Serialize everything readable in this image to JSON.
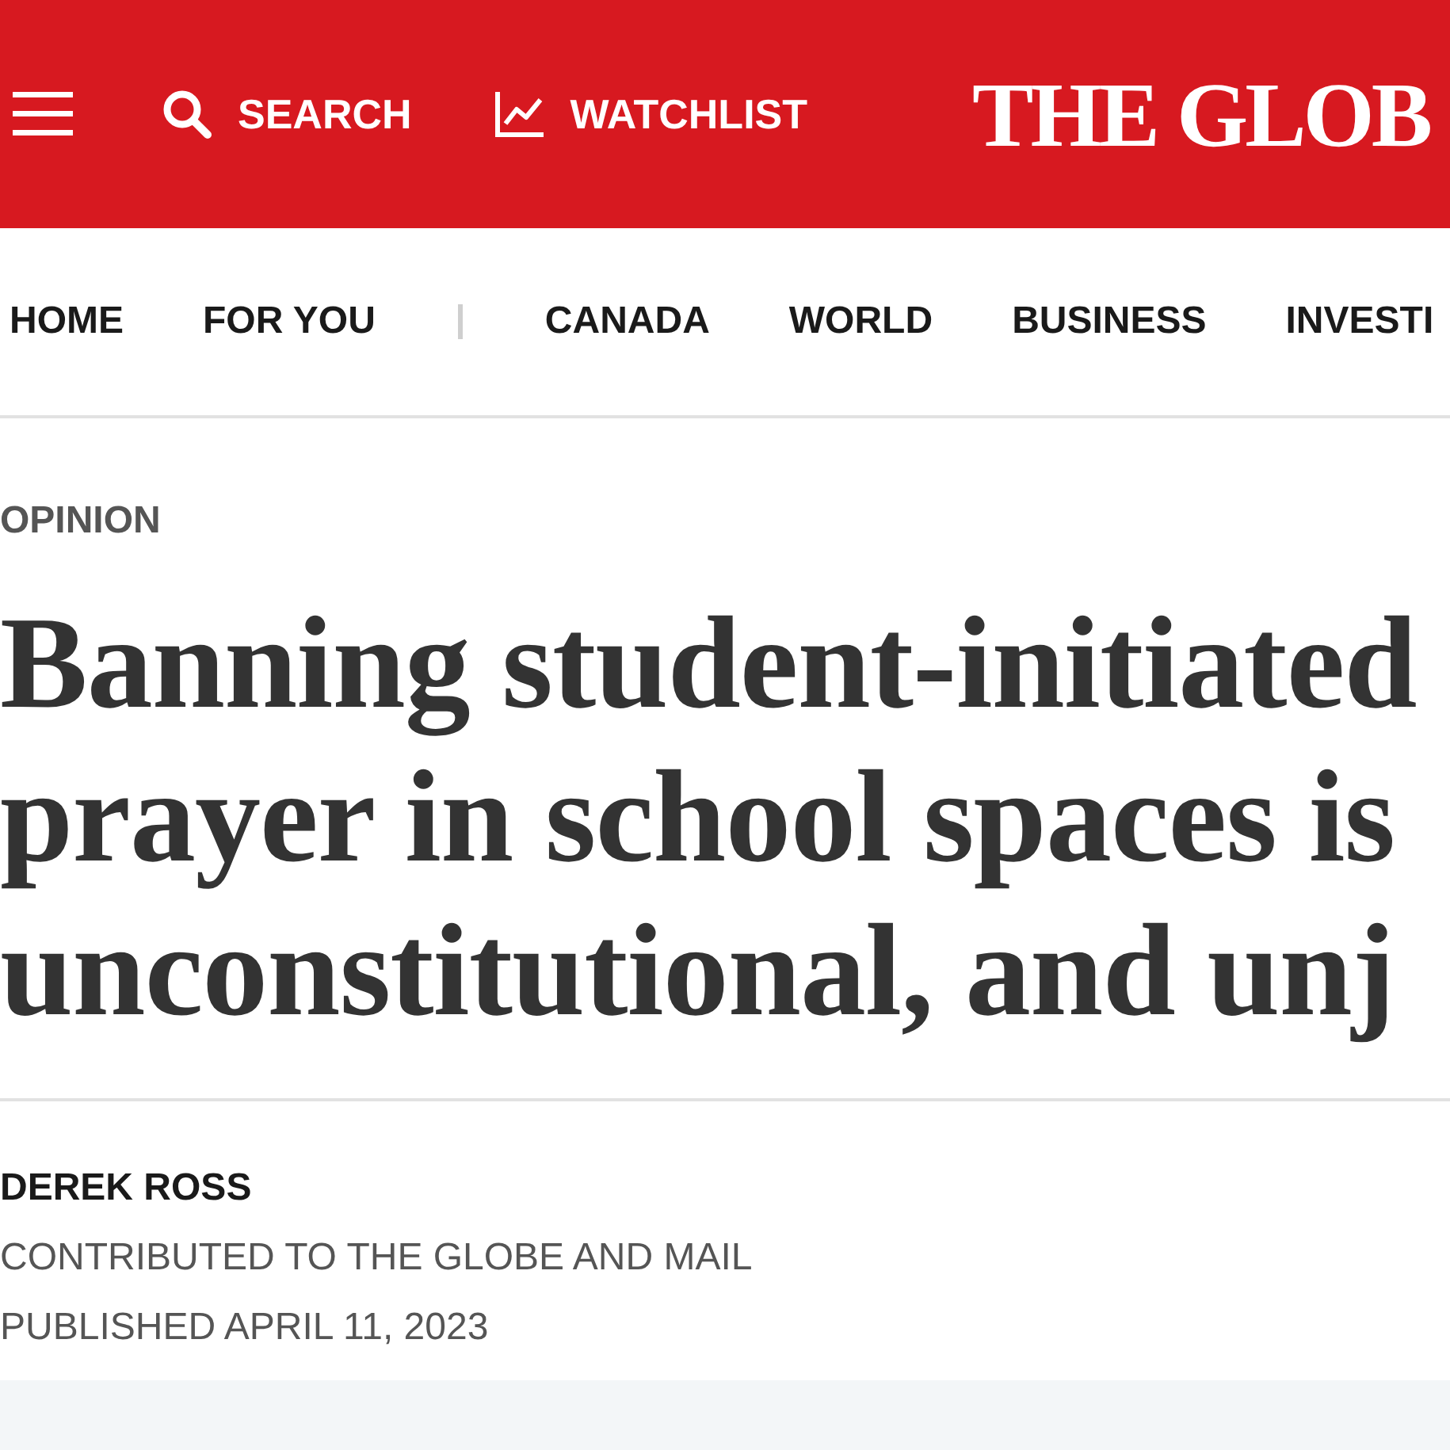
{
  "header": {
    "search": "SEARCH",
    "watchlist": "WATCHLIST",
    "logo": "THE GLOB"
  },
  "nav": {
    "primary": [
      {
        "label": "HOME"
      },
      {
        "label": "FOR YOU"
      }
    ],
    "sections": [
      {
        "label": "CANADA"
      },
      {
        "label": "WORLD"
      },
      {
        "label": "BUSINESS"
      },
      {
        "label": "INVESTI"
      }
    ]
  },
  "article": {
    "section": "OPINION",
    "headline_lines": [
      "Banning student-initiated",
      "prayer in school spaces is",
      "unconstitutional, and unj"
    ],
    "author": "DEREK ROSS",
    "contribution": "CONTRIBUTED TO THE GLOBE AND MAIL",
    "published": "PUBLISHED APRIL 11, 2023"
  }
}
